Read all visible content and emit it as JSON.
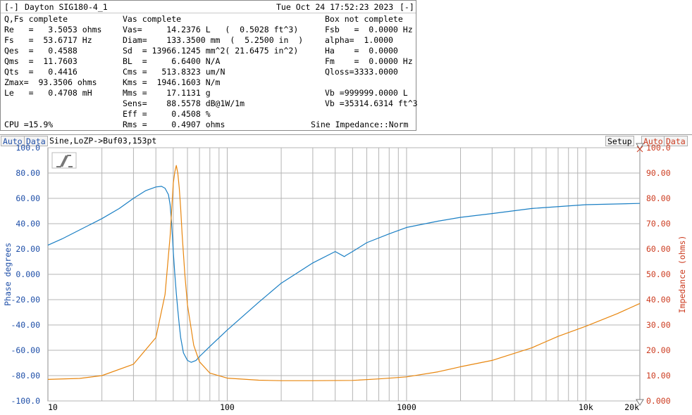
{
  "window": {
    "menu_left": "[-]",
    "title": "Dayton SIG180-4_1",
    "datetime": "Tue Oct 24 17:52:23 2023",
    "menu_right": "[-]"
  },
  "sections": {
    "qfs": "Q,Fs complete",
    "vas": "Vas complete",
    "box": "Box not complete"
  },
  "params_col1": [
    {
      "text": "Re   =   3.5053 ohms"
    },
    {
      "text": "Fs   =  53.6717 Hz"
    },
    {
      "text": "Qes  =   0.4588"
    },
    {
      "text": "Qms  =  11.7603"
    },
    {
      "text": "Qts  =   0.4416"
    },
    {
      "text": "Zmax=  93.3506 ohms"
    },
    {
      "text": "Le   =   0.4708 mH"
    }
  ],
  "params_col2": [
    {
      "text": "Vas=     14.2376 L   (  0.5028 ft^3)"
    },
    {
      "text": "Diam=    133.3500 mm  (  5.2500 in  )"
    },
    {
      "text": "Sd  = 13966.1245 mm^2( 21.6475 in^2)"
    },
    {
      "text": "BL  =     6.6400 N/A"
    },
    {
      "text": "Cms =   513.8323 um/N"
    },
    {
      "text": "Kms =  1946.1603 N/m"
    },
    {
      "text": "Mms =    17.1131 g"
    },
    {
      "text": "Sens=    88.5578 dB@1W/1m"
    },
    {
      "text": "Eff =     0.4508 %"
    },
    {
      "text": "Rms =     0.4907 ohms"
    }
  ],
  "params_col3": [
    {
      "text": "Fsb   =  0.0000 Hz"
    },
    {
      "text": "alpha=  1.0000"
    },
    {
      "text": "Ha    =  0.0000"
    },
    {
      "text": "Fm    =  0.0000 Hz"
    },
    {
      "text": "Qloss=3333.0000"
    },
    {
      "text": ""
    },
    {
      "text": "Vb =999999.0000 L"
    },
    {
      "text": "Vb =35314.6314 ft^3"
    }
  ],
  "status": {
    "cpu": "CPU =15.9%",
    "mode": "Sine Impedance::Norm"
  },
  "graph_header": {
    "auto_left": "Auto",
    "data_left": "Data",
    "source": "Sine,LoZP->Buf03,153pt",
    "setup": "Setup",
    "auto_right": "Auto",
    "data_right": "Data"
  },
  "colors": {
    "phase": "#1a7fc4",
    "impedance": "#e8860e",
    "left_axis": "#1f4fa8",
    "right_axis": "#cc3b1f",
    "grid": "#b4b4b4"
  },
  "chart_data": {
    "type": "line",
    "x_scale": "log",
    "xlim": [
      10,
      20000
    ],
    "x_tick_labels": [
      "10",
      "100",
      "1000",
      "10k",
      "20k"
    ],
    "x_tick_values": [
      10,
      100,
      1000,
      10000,
      20000
    ],
    "ylabel_left": "Phase degrees",
    "ylabel_right": "Impedance (ohms)",
    "ylim_left": [
      -100,
      100
    ],
    "ylim_right": [
      0,
      100
    ],
    "y_ticks_left": [
      "100.0",
      "80.00",
      "60.00",
      "40.00",
      "20.00",
      "0.000",
      "-20.00",
      "-40.00",
      "-60.00",
      "-80.00",
      "-100.0"
    ],
    "y_ticks_right": [
      "100.0",
      "90.00",
      "80.00",
      "70.00",
      "60.00",
      "50.00",
      "40.00",
      "30.00",
      "20.00",
      "10.00",
      "0.000"
    ],
    "grid": true,
    "series": [
      {
        "axis": "left",
        "x": [
          10,
          12,
          15,
          20,
          25,
          30,
          35,
          40,
          43,
          45,
          47,
          48,
          49,
          50,
          51,
          52,
          53,
          54,
          55,
          57,
          60,
          63,
          67,
          70,
          80,
          100,
          150,
          200,
          300,
          400,
          450,
          460,
          500,
          600,
          800,
          1000,
          1500,
          2000,
          3000,
          5000,
          10000,
          20000
        ],
        "y": [
          23,
          28,
          35,
          44,
          52,
          60,
          66,
          69,
          69.5,
          68,
          63,
          55,
          40,
          18,
          0,
          -15,
          -28,
          -40,
          -50,
          -62,
          -68,
          -69.5,
          -68,
          -65,
          -57,
          -44,
          -22,
          -7,
          9,
          18,
          14,
          15,
          18,
          25,
          32,
          37,
          42,
          45,
          48,
          52,
          55,
          56
        ]
      },
      {
        "axis": "right",
        "x": [
          10,
          15,
          20,
          30,
          40,
          45,
          48,
          50,
          51,
          52,
          53,
          54,
          55,
          56,
          58,
          60,
          65,
          70,
          80,
          100,
          150,
          200,
          300,
          500,
          700,
          1000,
          1500,
          2000,
          3000,
          5000,
          7000,
          10000,
          15000,
          20000
        ],
        "y": [
          8.5,
          8.9,
          10,
          14.5,
          25,
          42,
          65,
          86,
          90.5,
          93,
          90,
          84,
          76,
          66,
          50,
          38,
          22,
          15.5,
          11,
          9,
          8.2,
          8.0,
          8.0,
          8.1,
          8.7,
          9.5,
          11.5,
          13.5,
          16,
          21,
          25.5,
          29.5,
          34.5,
          38.5
        ]
      }
    ]
  }
}
